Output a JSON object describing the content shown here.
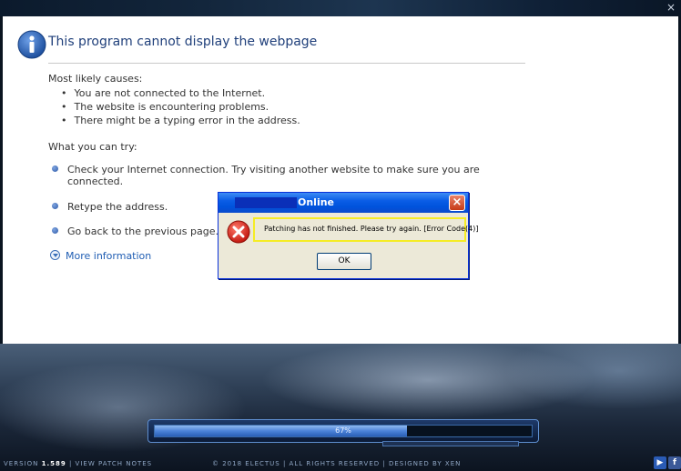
{
  "window": {
    "close_glyph": "×"
  },
  "ie_page": {
    "title": "This program cannot display the webpage",
    "causes_heading": "Most likely causes:",
    "causes": [
      "You are not connected to the Internet.",
      "The website is encountering problems.",
      "There might be a typing error in the address."
    ],
    "try_heading": "What you can try:",
    "try_items": [
      "Check your Internet connection. Try visiting another website to make sure you are connected.",
      "Retype the address.",
      "Go back to the previous page."
    ],
    "more_info": "More information"
  },
  "dialog": {
    "title": "Online",
    "message": "Patching has not finished. Please try again. [Error Code(4)]",
    "ok_label": "OK",
    "icon": "error-icon"
  },
  "launcher": {
    "progress_percent": 67,
    "progress_label": "67%",
    "version_label": "VERSION",
    "version_number": "1.589",
    "patch_notes": "| VIEW PATCH NOTES",
    "copyright": "© 2018 ELECTUS | ALL RIGHTS RESERVED | DESIGNED BY XEN",
    "youtube_label": "▶",
    "facebook_label": "f"
  }
}
